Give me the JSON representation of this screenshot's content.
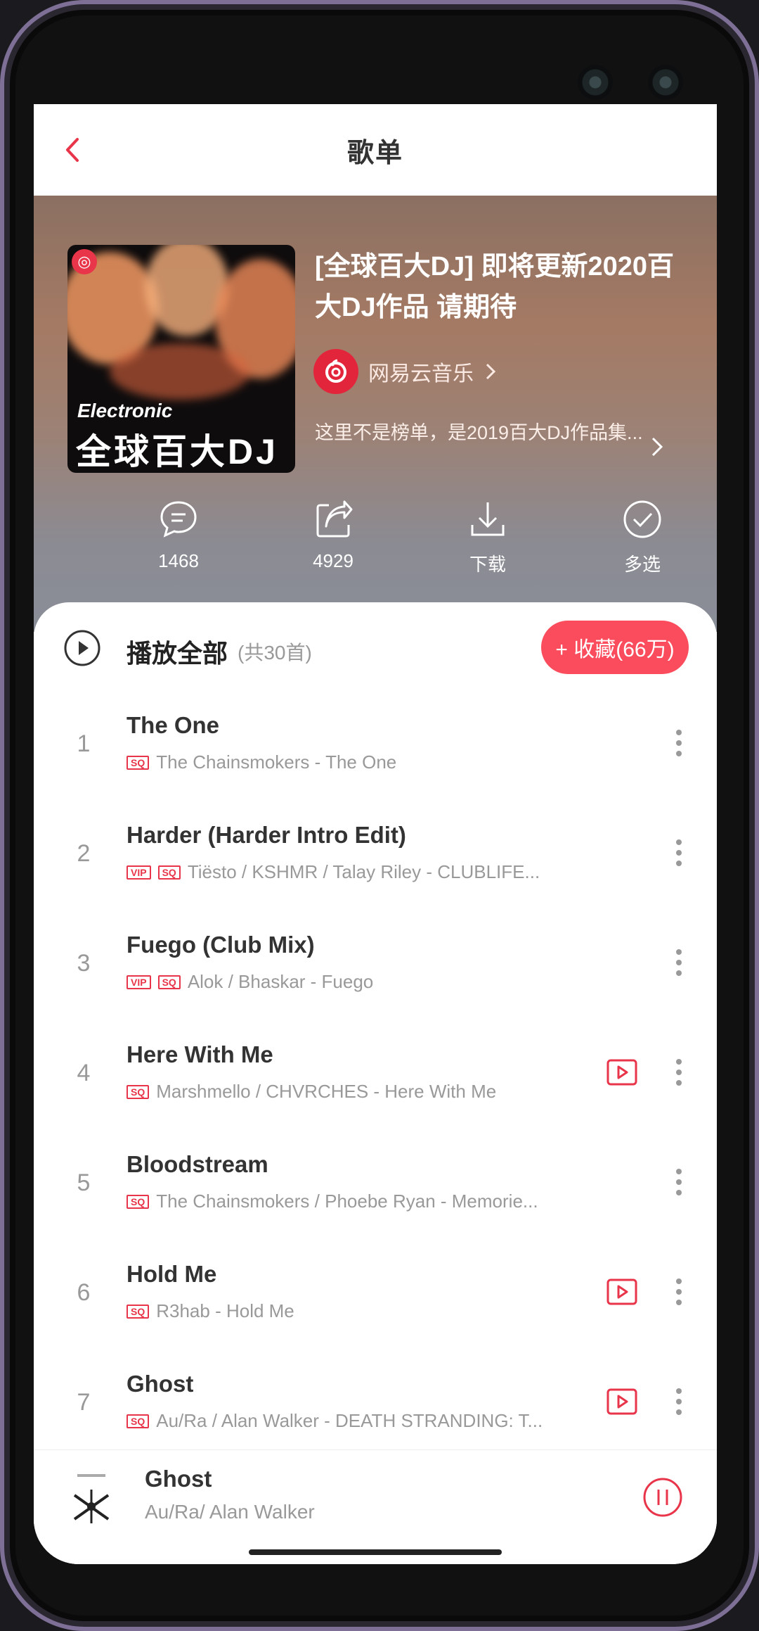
{
  "topbar": {
    "title": "歌单"
  },
  "playlist": {
    "cover_tag": "Electronic",
    "cover_title": "全球百大DJ",
    "title": "[全球百大DJ] 即将更新2020百大DJ作品 请期待",
    "creator": "网易云音乐",
    "description": "这里不是榜单，是2019百大DJ作品集..."
  },
  "actions": [
    {
      "icon": "comment-icon",
      "label": "1468"
    },
    {
      "icon": "share-icon",
      "label": "4929"
    },
    {
      "icon": "download-icon",
      "label": "下载"
    },
    {
      "icon": "multi-select-icon",
      "label": "多选"
    }
  ],
  "list": {
    "play_all": "播放全部",
    "count": "(共30首)",
    "favorite": "+ 收藏(66万)",
    "songs": [
      {
        "index": "1",
        "title": "The One",
        "tags": [
          "SQ"
        ],
        "artist": "The Chainsmokers - The One",
        "mv": false
      },
      {
        "index": "2",
        "title": "Harder (Harder Intro Edit)",
        "tags": [
          "VIP",
          "SQ"
        ],
        "artist": "Tiësto / KSHMR / Talay Riley - CLUBLIFE...",
        "mv": false
      },
      {
        "index": "3",
        "title": "Fuego (Club Mix)",
        "tags": [
          "VIP",
          "SQ"
        ],
        "artist": "Alok / Bhaskar - Fuego",
        "mv": false
      },
      {
        "index": "4",
        "title": "Here With Me",
        "tags": [
          "SQ"
        ],
        "artist": "Marshmello / CHVRCHES - Here With Me",
        "mv": true
      },
      {
        "index": "5",
        "title": "Bloodstream",
        "tags": [
          "SQ"
        ],
        "artist": "The Chainsmokers / Phoebe Ryan - Memorie...",
        "mv": false
      },
      {
        "index": "6",
        "title": "Hold Me",
        "tags": [
          "SQ"
        ],
        "artist": "R3hab - Hold Me",
        "mv": true
      },
      {
        "index": "7",
        "title": "Ghost",
        "tags": [
          "SQ"
        ],
        "artist": "Au/Ra / Alan Walker - DEATH STRANDING: T...",
        "mv": true
      }
    ]
  },
  "player": {
    "title": "Ghost",
    "artist": "Au/Ra/ Alan Walker"
  },
  "colors": {
    "accent": "#e8354a",
    "button": "#fb4c5d"
  }
}
